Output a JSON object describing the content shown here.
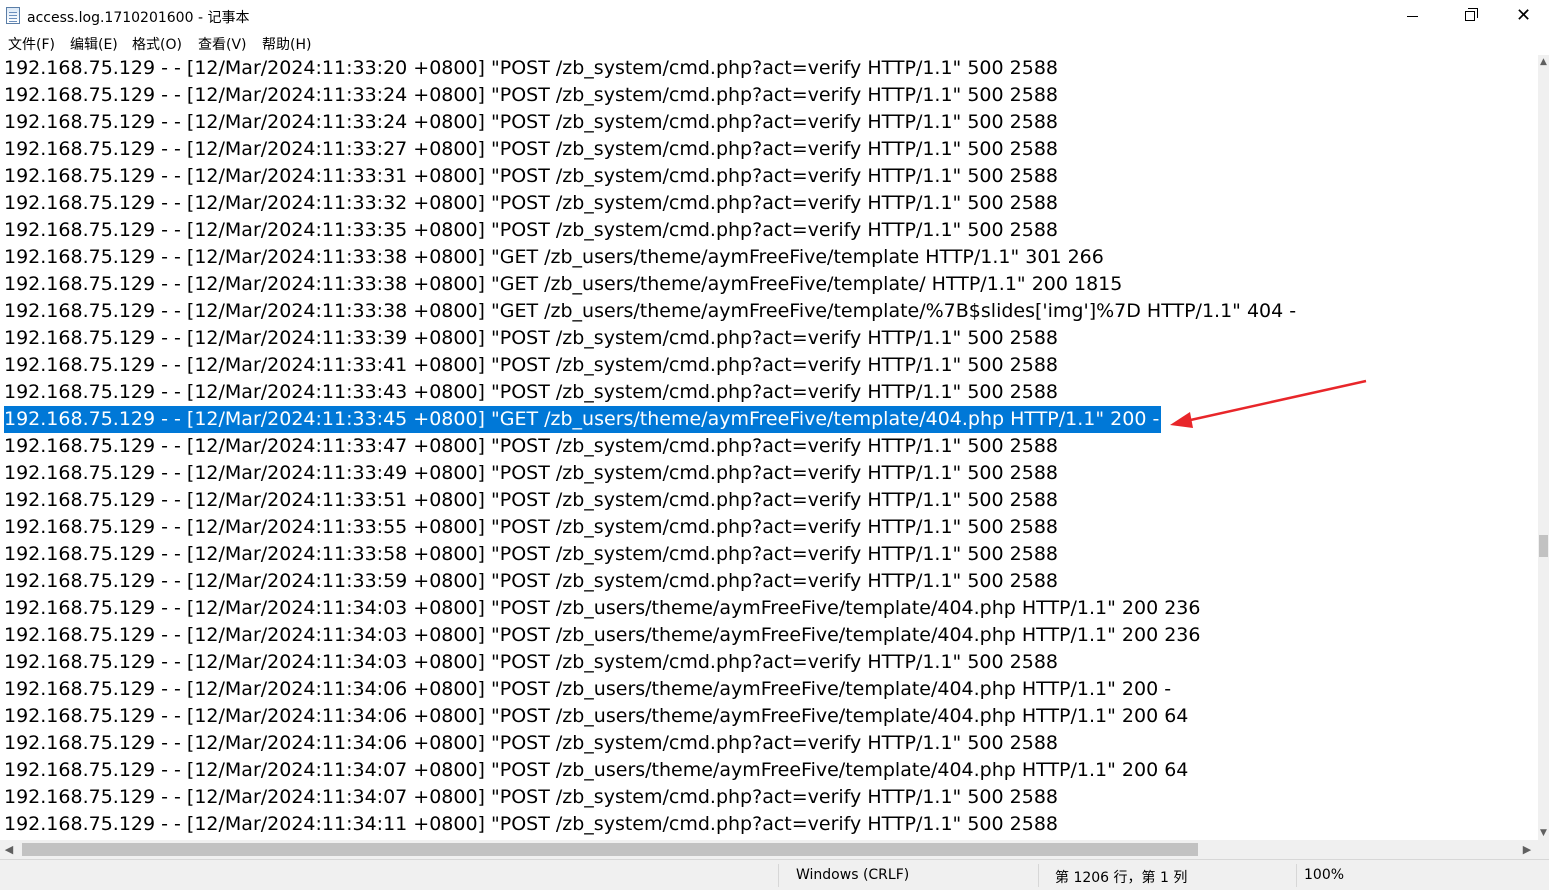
{
  "window": {
    "title": "access.log.1710201600 - 记事本",
    "minimize_label": "—",
    "close_label": "✕"
  },
  "menu": {
    "items": [
      "文件(F)",
      "编辑(E)",
      "格式(O)",
      "查看(V)",
      "帮助(H)"
    ]
  },
  "editor": {
    "selected_line_index": 13,
    "lines": [
      "192.168.75.129 - - [12/Mar/2024:11:33:20 +0800] \"POST /zb_system/cmd.php?act=verify HTTP/1.1\" 500 2588",
      "192.168.75.129 - - [12/Mar/2024:11:33:24 +0800] \"POST /zb_system/cmd.php?act=verify HTTP/1.1\" 500 2588",
      "192.168.75.129 - - [12/Mar/2024:11:33:24 +0800] \"POST /zb_system/cmd.php?act=verify HTTP/1.1\" 500 2588",
      "192.168.75.129 - - [12/Mar/2024:11:33:27 +0800] \"POST /zb_system/cmd.php?act=verify HTTP/1.1\" 500 2588",
      "192.168.75.129 - - [12/Mar/2024:11:33:31 +0800] \"POST /zb_system/cmd.php?act=verify HTTP/1.1\" 500 2588",
      "192.168.75.129 - - [12/Mar/2024:11:33:32 +0800] \"POST /zb_system/cmd.php?act=verify HTTP/1.1\" 500 2588",
      "192.168.75.129 - - [12/Mar/2024:11:33:35 +0800] \"POST /zb_system/cmd.php?act=verify HTTP/1.1\" 500 2588",
      "192.168.75.129 - - [12/Mar/2024:11:33:38 +0800] \"GET /zb_users/theme/aymFreeFive/template HTTP/1.1\" 301 266",
      "192.168.75.129 - - [12/Mar/2024:11:33:38 +0800] \"GET /zb_users/theme/aymFreeFive/template/ HTTP/1.1\" 200 1815",
      "192.168.75.129 - - [12/Mar/2024:11:33:38 +0800] \"GET /zb_users/theme/aymFreeFive/template/%7B$slides['img']%7D HTTP/1.1\" 404 -",
      "192.168.75.129 - - [12/Mar/2024:11:33:39 +0800] \"POST /zb_system/cmd.php?act=verify HTTP/1.1\" 500 2588",
      "192.168.75.129 - - [12/Mar/2024:11:33:41 +0800] \"POST /zb_system/cmd.php?act=verify HTTP/1.1\" 500 2588",
      "192.168.75.129 - - [12/Mar/2024:11:33:43 +0800] \"POST /zb_system/cmd.php?act=verify HTTP/1.1\" 500 2588",
      "192.168.75.129 - - [12/Mar/2024:11:33:45 +0800] \"GET /zb_users/theme/aymFreeFive/template/404.php HTTP/1.1\" 200 -",
      "192.168.75.129 - - [12/Mar/2024:11:33:47 +0800] \"POST /zb_system/cmd.php?act=verify HTTP/1.1\" 500 2588",
      "192.168.75.129 - - [12/Mar/2024:11:33:49 +0800] \"POST /zb_system/cmd.php?act=verify HTTP/1.1\" 500 2588",
      "192.168.75.129 - - [12/Mar/2024:11:33:51 +0800] \"POST /zb_system/cmd.php?act=verify HTTP/1.1\" 500 2588",
      "192.168.75.129 - - [12/Mar/2024:11:33:55 +0800] \"POST /zb_system/cmd.php?act=verify HTTP/1.1\" 500 2588",
      "192.168.75.129 - - [12/Mar/2024:11:33:58 +0800] \"POST /zb_system/cmd.php?act=verify HTTP/1.1\" 500 2588",
      "192.168.75.129 - - [12/Mar/2024:11:33:59 +0800] \"POST /zb_system/cmd.php?act=verify HTTP/1.1\" 500 2588",
      "192.168.75.129 - - [12/Mar/2024:11:34:03 +0800] \"POST /zb_users/theme/aymFreeFive/template/404.php HTTP/1.1\" 200 236",
      "192.168.75.129 - - [12/Mar/2024:11:34:03 +0800] \"POST /zb_users/theme/aymFreeFive/template/404.php HTTP/1.1\" 200 236",
      "192.168.75.129 - - [12/Mar/2024:11:34:03 +0800] \"POST /zb_system/cmd.php?act=verify HTTP/1.1\" 500 2588",
      "192.168.75.129 - - [12/Mar/2024:11:34:06 +0800] \"POST /zb_users/theme/aymFreeFive/template/404.php HTTP/1.1\" 200 -",
      "192.168.75.129 - - [12/Mar/2024:11:34:06 +0800] \"POST /zb_users/theme/aymFreeFive/template/404.php HTTP/1.1\" 200 64",
      "192.168.75.129 - - [12/Mar/2024:11:34:06 +0800] \"POST /zb_system/cmd.php?act=verify HTTP/1.1\" 500 2588",
      "192.168.75.129 - - [12/Mar/2024:11:34:07 +0800] \"POST /zb_users/theme/aymFreeFive/template/404.php HTTP/1.1\" 200 64",
      "192.168.75.129 - - [12/Mar/2024:11:34:07 +0800] \"POST /zb_system/cmd.php?act=verify HTTP/1.1\" 500 2588",
      "192.168.75.129 - - [12/Mar/2024:11:34:11 +0800] \"POST /zb_system/cmd.php?act=verify HTTP/1.1\" 500 2588"
    ]
  },
  "statusbar": {
    "encoding": "Windows (CRLF)",
    "position": "第 1206 行，第 1 列",
    "zoom": "100%"
  },
  "colors": {
    "selection": "#0078d7",
    "annotation_arrow": "#e8262a"
  }
}
